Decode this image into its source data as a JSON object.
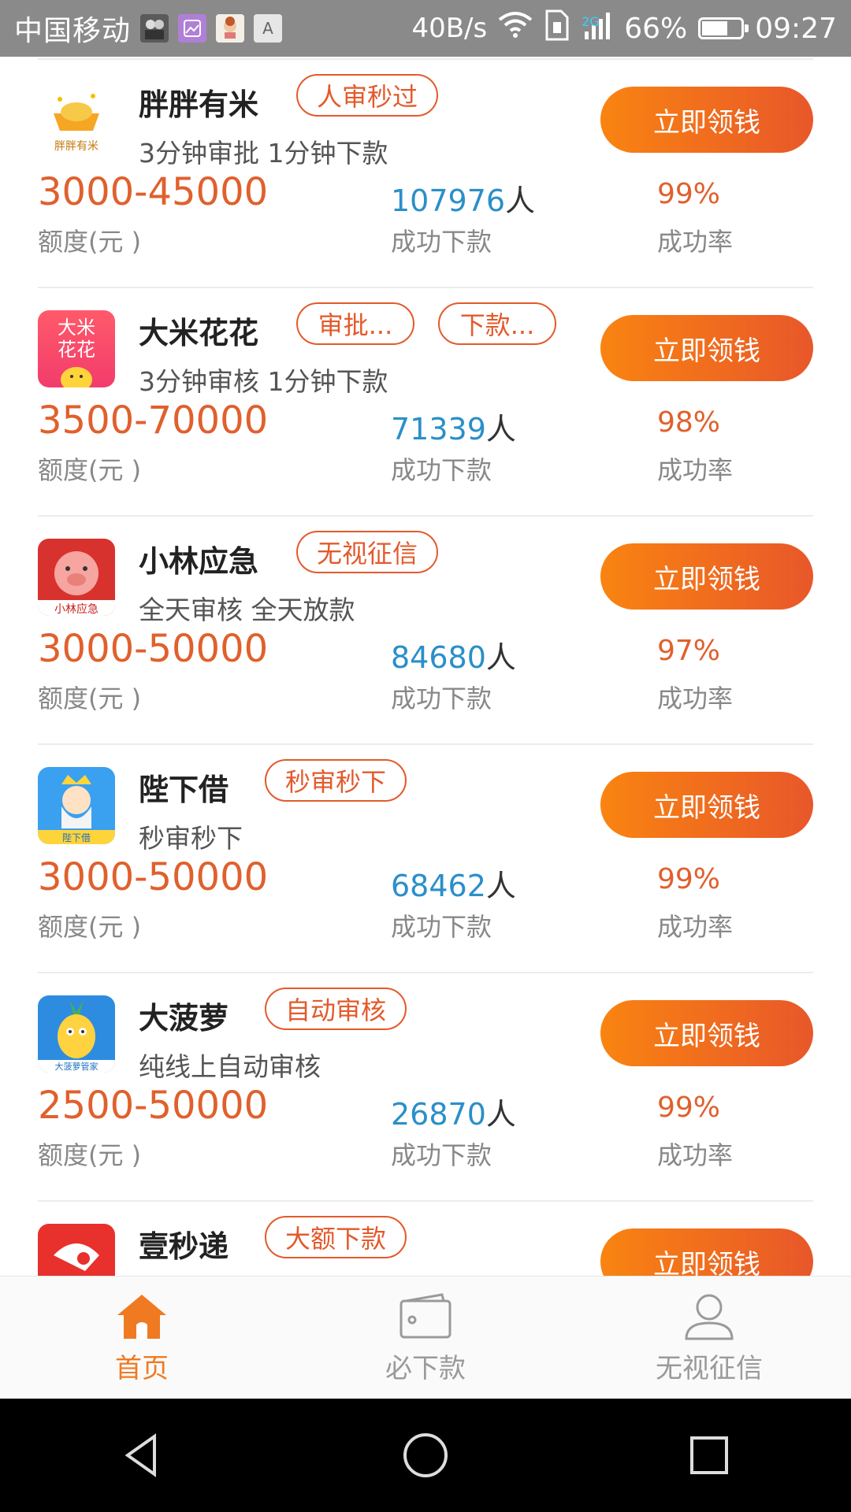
{
  "status_bar": {
    "carrier": "中国移动",
    "net_speed": "40B/s",
    "network_gen": "2G",
    "battery_percent": "66%",
    "battery_level": 0.66,
    "time": "09:27"
  },
  "loans": [
    {
      "name": "胖胖有米",
      "tags": [
        "人审秒过"
      ],
      "desc": "3分钟审批 1分钟下款",
      "amount": "3000-45000",
      "amount_label": "额度(元 )",
      "count": "107976",
      "count_unit": "人",
      "count_label": "成功下款",
      "rate": "99%",
      "rate_label": "成功率",
      "cta": "立即领钱",
      "logo_text": "胖胖有米"
    },
    {
      "name": "大米花花",
      "tags": [
        "审批...",
        "下款..."
      ],
      "desc": "3分钟审核 1分钟下款",
      "amount": "3500-70000",
      "amount_label": "额度(元 )",
      "count": "71339",
      "count_unit": "人",
      "count_label": "成功下款",
      "rate": "98%",
      "rate_label": "成功率",
      "cta": "立即领钱",
      "logo_text": "大米花花"
    },
    {
      "name": "小林应急",
      "tags": [
        "无视征信"
      ],
      "desc": "全天审核 全天放款",
      "amount": "3000-50000",
      "amount_label": "额度(元 )",
      "count": "84680",
      "count_unit": "人",
      "count_label": "成功下款",
      "rate": "97%",
      "rate_label": "成功率",
      "cta": "立即领钱",
      "logo_text": "小林应急"
    },
    {
      "name": "陛下借",
      "tags": [
        "秒审秒下"
      ],
      "desc": "秒审秒下",
      "amount": "3000-50000",
      "amount_label": "额度(元 )",
      "count": "68462",
      "count_unit": "人",
      "count_label": "成功下款",
      "rate": "99%",
      "rate_label": "成功率",
      "cta": "立即领钱",
      "logo_text": "陛下借"
    },
    {
      "name": "大菠萝",
      "tags": [
        "自动审核"
      ],
      "desc": "纯线上自动审核",
      "amount": "2500-50000",
      "amount_label": "额度(元 )",
      "count": "26870",
      "count_unit": "人",
      "count_label": "成功下款",
      "rate": "99%",
      "rate_label": "成功率",
      "cta": "立即领钱",
      "logo_text": "大菠萝管家"
    },
    {
      "name": "壹秒递",
      "tags": [
        "大额下款"
      ],
      "desc": "",
      "amount": "",
      "amount_label": "",
      "count": "",
      "count_unit": "",
      "count_label": "",
      "rate": "",
      "rate_label": "",
      "cta": "立即领钱",
      "logo_text": ""
    }
  ],
  "bottom_nav": [
    {
      "label": "首页",
      "icon": "home-icon",
      "active": true
    },
    {
      "label": "必下款",
      "icon": "wallet-icon",
      "active": false
    },
    {
      "label": "无视征信",
      "icon": "person-icon",
      "active": false
    }
  ],
  "colors": {
    "accent": "#f07a22",
    "amount": "#e0602d",
    "count": "#2a8fc9",
    "tag": "#e35a2b"
  }
}
